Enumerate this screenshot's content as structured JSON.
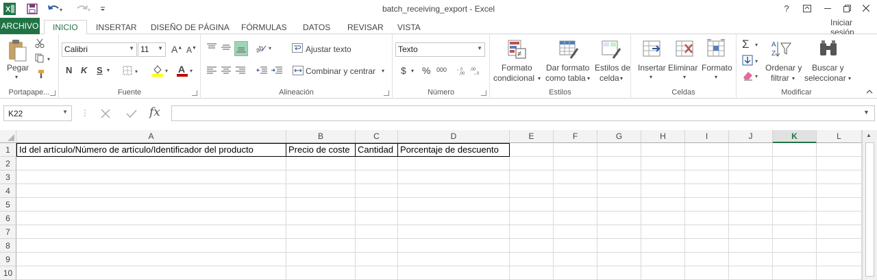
{
  "window": {
    "title": "batch_receiving_export - Excel",
    "help": "?",
    "sign_in": "Iniciar sesión"
  },
  "tabs": [
    "ARCHIVO",
    "INICIO",
    "INSERTAR",
    "DISEÑO DE PÁGINA",
    "FÓRMULAS",
    "DATOS",
    "REVISAR",
    "VISTA"
  ],
  "ribbon": {
    "clipboard": {
      "label": "Portapape...",
      "paste": "Pegar"
    },
    "font": {
      "label": "Fuente",
      "name": "Calibri",
      "size": "11",
      "bold": "N",
      "italic": "K",
      "underline": "S"
    },
    "alignment": {
      "label": "Alineación",
      "wrap": "Ajustar texto",
      "merge": "Combinar y centrar"
    },
    "number": {
      "label": "Número",
      "format": "Texto",
      "percent": "%",
      "thousands": "000",
      "currency": "$"
    },
    "styles": {
      "label": "Estilos",
      "cond_1": "Formato",
      "cond_2": "condicional",
      "table_1": "Dar formato",
      "table_2": "como tabla",
      "cell_1": "Estilos de",
      "cell_2": "celda"
    },
    "cells": {
      "label": "Celdas",
      "insert": "Insertar",
      "delete": "Eliminar",
      "format": "Formato"
    },
    "editing": {
      "label": "Modificar",
      "sort_1": "Ordenar y",
      "sort_2": "filtrar",
      "find_1": "Buscar y",
      "find_2": "seleccionar"
    }
  },
  "formula_bar": {
    "name_box": "K22",
    "fx": "fx",
    "value": ""
  },
  "sheet": {
    "columns": [
      "A",
      "B",
      "C",
      "D",
      "E",
      "F",
      "G",
      "H",
      "I",
      "J",
      "K",
      "L"
    ],
    "selected_column": "K",
    "rows": [
      "1",
      "2",
      "3",
      "4",
      "5",
      "6",
      "7",
      "8",
      "9",
      "10"
    ],
    "row1": [
      "Id del artículo/Número de artículo/Identificador del producto",
      "Precio de coste",
      "Cantidad",
      "Porcentaje de descuento"
    ]
  },
  "colors": {
    "accent": "#217346",
    "red": "#c00000",
    "highlight": "#ffff00"
  }
}
